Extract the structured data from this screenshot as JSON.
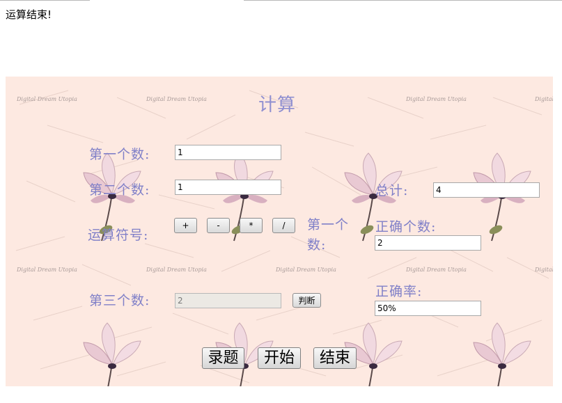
{
  "status_message": "运算结束!",
  "panel": {
    "title": "计算",
    "watermark": "Digital Dream Utopia",
    "fields": {
      "first_number": {
        "label": "第一个数:",
        "value": "1"
      },
      "second_number": {
        "label": "第二个数:",
        "value": "1"
      },
      "third_number": {
        "label": "第三个数:",
        "value": "2"
      }
    },
    "operator_label": "运算符号:",
    "operators": [
      "+",
      "-",
      "*",
      "/"
    ],
    "judge_button": "判断",
    "first_count_label": "第一个数:",
    "stats": {
      "total": {
        "label": "总计:",
        "value": "4"
      },
      "correct_count": {
        "label": "正确个数:",
        "value": "2"
      },
      "accuracy": {
        "label": "正确率:",
        "value": "50%"
      }
    },
    "actions": {
      "record": "录题",
      "start": "开始",
      "end": "结束"
    }
  }
}
